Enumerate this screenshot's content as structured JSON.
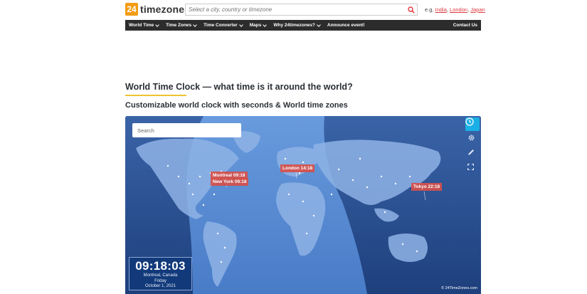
{
  "header": {
    "logo_number": "24",
    "logo_text": "timezones",
    "search_placeholder": "Select a city, country or timezone",
    "examples_prefix": "e.g.",
    "examples": [
      "India",
      "London",
      "Japan"
    ]
  },
  "nav": {
    "items": [
      {
        "label": "World Time",
        "dropdown": true
      },
      {
        "label": "Time Zones",
        "dropdown": true
      },
      {
        "label": "Time Converter",
        "dropdown": true
      },
      {
        "label": "Maps",
        "dropdown": true
      },
      {
        "label": "Why 24timezones?",
        "dropdown": true
      },
      {
        "label": "Announce event!",
        "dropdown": false
      }
    ],
    "right_label": "Contact Us"
  },
  "main": {
    "title": "World Time Clock — what time is it around the world?",
    "subtitle": "Customizable world clock with seconds & World time zones"
  },
  "map": {
    "search_placeholder": "Search",
    "city_labels": {
      "montreal": "Montreal 09:18",
      "new_york": "New York 09:18",
      "london": "London 14:18",
      "tokyo": "Tokyo 22:18"
    },
    "tools": [
      "clock-icon",
      "gear-icon",
      "pencil-icon",
      "fullscreen-icon"
    ],
    "clock": {
      "time": "09:18:03",
      "location": "Montreal, Canada",
      "weekday": "Friday",
      "date": "October 1, 2021"
    },
    "copyright": "© 24TimeZones.com"
  },
  "colors": {
    "accent": "#f39c12",
    "nav_bg": "#2c2c2c",
    "map_night": "#2a4d8c",
    "map_day": "#5b8fd6",
    "city_label": "#d6504a",
    "clock_button": "#1ab0e5",
    "link": "#e0393e"
  }
}
